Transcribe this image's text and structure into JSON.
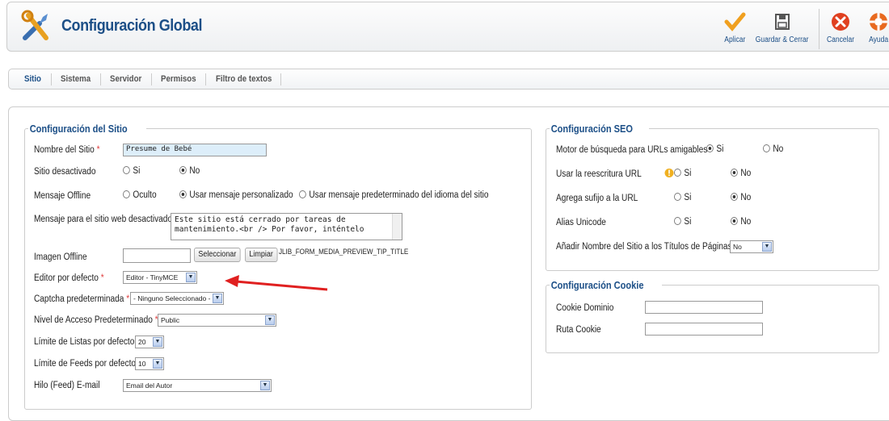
{
  "header": {
    "title": "Configuración Global",
    "buttons": {
      "apply": "Aplicar",
      "save_close": "Guardar & Cerrar",
      "cancel": "Cancelar",
      "help": "Ayuda"
    }
  },
  "tabs": [
    "Sitio",
    "Sistema",
    "Servidor",
    "Permisos",
    "Filtro de textos"
  ],
  "site": {
    "legend": "Configuración del Sitio",
    "site_name_label": "Nombre del Sitio",
    "site_name_value": "Presume de Bebé",
    "offline_label": "Sitio desactivado",
    "offline_yes": "Si",
    "offline_no": "No",
    "offline_message_label": "Mensaje Offline",
    "msg_hidden": "Oculto",
    "msg_custom": "Usar mensaje personalizado",
    "msg_default": "Usar mensaje predeterminado del idioma del sitio",
    "offline_text_label": "Mensaje para el sitio web desactivado",
    "offline_text_line1": "Este sitio está cerrado por tareas de",
    "offline_text_line2": "mantenimiento.<br /> Por favor, inténtelo",
    "offline_image_label": "Imagen Offline",
    "select_button": "Seleccionar",
    "clear_button": "Limpiar",
    "media_preview_key": "JLIB_FORM_MEDIA_PREVIEW_TIP_TITLE",
    "editor_label": "Editor por defecto",
    "editor_value": "Editor - TinyMCE",
    "captcha_label": "Captcha predeterminada",
    "captcha_value": "- Ninguno Seleccionado -",
    "access_label": "Nivel de Acceso Predeterminado",
    "access_value": "Public",
    "list_limit_label": "Límite de Listas por defecto",
    "list_limit_value": "20",
    "feed_limit_label": "Límite de Feeds por defecto",
    "feed_limit_value": "10",
    "feed_email_label": "Hilo (Feed) E-mail",
    "feed_email_value": "Email del Autor"
  },
  "seo": {
    "legend": "Configuración SEO",
    "sef_label": "Motor de búsqueda para URLs amigables",
    "rewrite_label": "Usar la reescritura URL",
    "suffix_label": "Agrega sufijo a la URL",
    "unicode_label": "Alias Unicode",
    "sitename_label": "Añadir Nombre del Sitio a los Títulos de Páginas",
    "sitename_value": "No",
    "yes": "Si",
    "no": "No"
  },
  "cookie": {
    "legend": "Configuración Cookie",
    "domain_label": "Cookie Dominio",
    "path_label": "Ruta Cookie"
  },
  "colors": {
    "brand": "#1c4f87",
    "annotation_arrow": "#e02020"
  }
}
